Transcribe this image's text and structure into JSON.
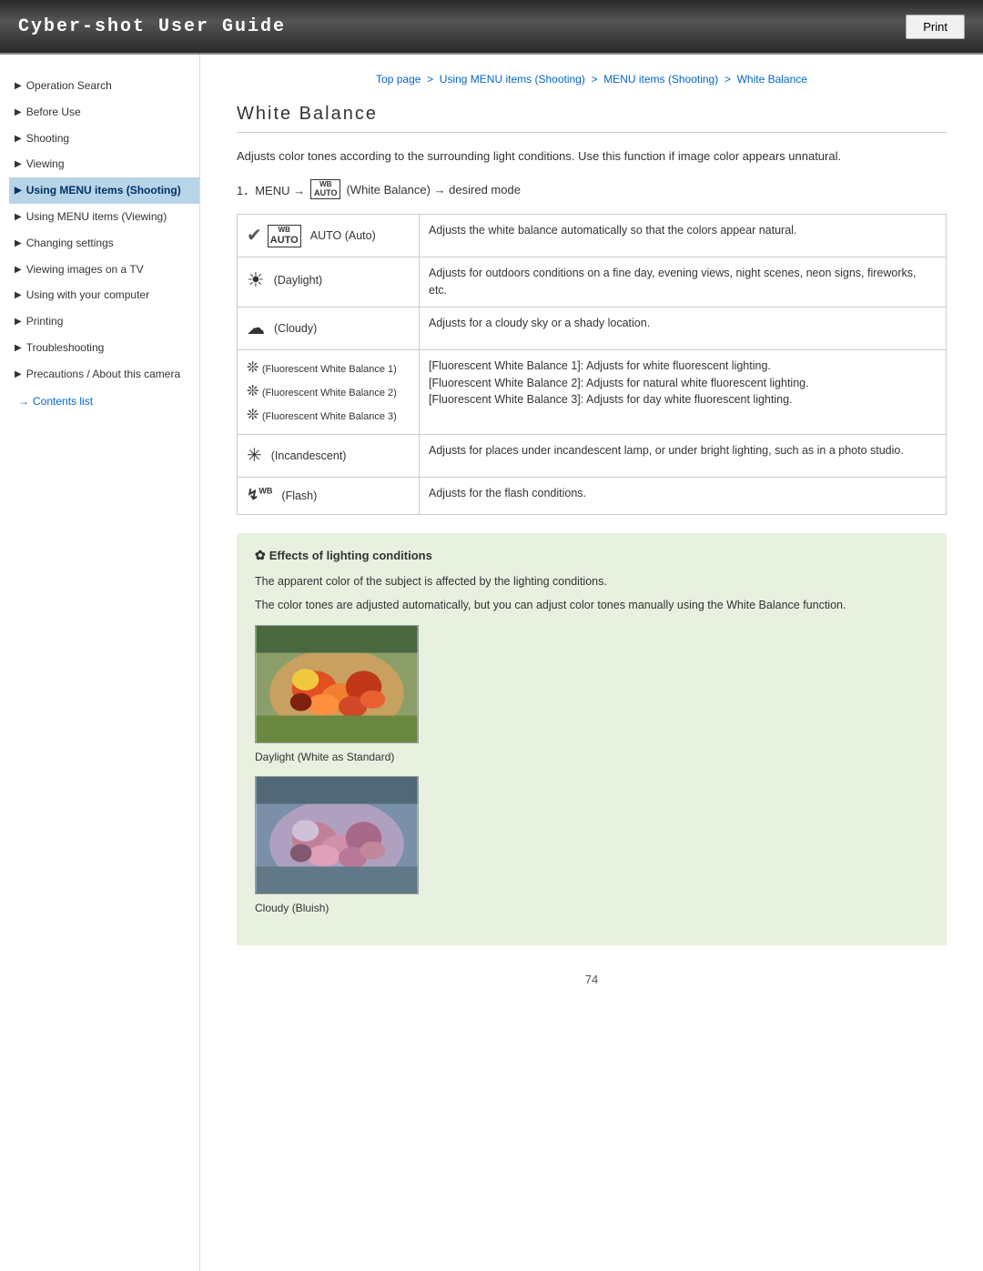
{
  "header": {
    "title": "Cyber-shot User Guide",
    "print_button": "Print"
  },
  "breadcrumb": {
    "text": "Top page > Using MENU items (Shooting) > MENU items (Shooting) > White Balance",
    "top_page": "Top page",
    "step1": "Using MENU items (Shooting)",
    "step2": "MENU items (Shooting)",
    "step3": "White Balance"
  },
  "page_title": "White Balance",
  "description": "Adjusts color tones according to the surrounding light conditions. Use this function if image color appears unnatural.",
  "step_text": "1．MENU →",
  "step_wb_label": "WB AUTO",
  "step_wb_sub": "(White Balance) → desired mode",
  "table": {
    "rows": [
      {
        "icon": "✓",
        "icon_type": "check",
        "label": "AUTO (Auto)",
        "description": "Adjusts the white balance automatically so that the colors appear natural."
      },
      {
        "icon": "☀",
        "icon_type": "sun",
        "label": "(Daylight)",
        "description": "Adjusts for outdoors conditions on a fine day, evening views, night scenes, neon signs, fireworks, etc."
      },
      {
        "icon": "☁",
        "icon_type": "cloud",
        "label": "(Cloudy)",
        "description": "Adjusts for a cloudy sky or a shady location."
      },
      {
        "icon": "fluor",
        "icon_type": "fluorescent",
        "label": "(Fluorescent White Balance 1)\n(Fluorescent White Balance 2)\n(Fluorescent White Balance 3)",
        "description": "[Fluorescent White Balance 1]: Adjusts for white fluorescent lighting.\n[Fluorescent White Balance 2]: Adjusts for natural white fluorescent lighting.\n[Fluorescent White Balance 3]: Adjusts for day white fluorescent lighting."
      },
      {
        "icon": "✳",
        "icon_type": "incandescent",
        "label": "(Incandescent)",
        "description": "Adjusts for places under incandescent lamp, or under bright lighting, such as in a photo studio."
      },
      {
        "icon": "⚡WB",
        "icon_type": "flash",
        "label": "(Flash)",
        "description": "Adjusts for the flash conditions."
      }
    ]
  },
  "note": {
    "title": "Effects of lighting conditions",
    "texts": [
      "The apparent color of the subject is affected by the lighting conditions.",
      "The color tones are adjusted automatically, but you can adjust color tones manually using the White Balance function."
    ],
    "caption1": "Daylight (White as Standard)",
    "caption2": "Cloudy (Bluish)"
  },
  "sidebar": {
    "items": [
      {
        "label": "Operation Search",
        "active": false
      },
      {
        "label": "Before Use",
        "active": false
      },
      {
        "label": "Shooting",
        "active": false
      },
      {
        "label": "Viewing",
        "active": false
      },
      {
        "label": "Using MENU items (Shooting)",
        "active": true
      },
      {
        "label": "Using MENU items (Viewing)",
        "active": false
      },
      {
        "label": "Changing settings",
        "active": false
      },
      {
        "label": "Viewing images on a TV",
        "active": false
      },
      {
        "label": "Using with your computer",
        "active": false
      },
      {
        "label": "Printing",
        "active": false
      },
      {
        "label": "Troubleshooting",
        "active": false
      },
      {
        "label": "Precautions / About this camera",
        "active": false
      }
    ],
    "contents_link": "Contents list"
  },
  "page_number": "74"
}
